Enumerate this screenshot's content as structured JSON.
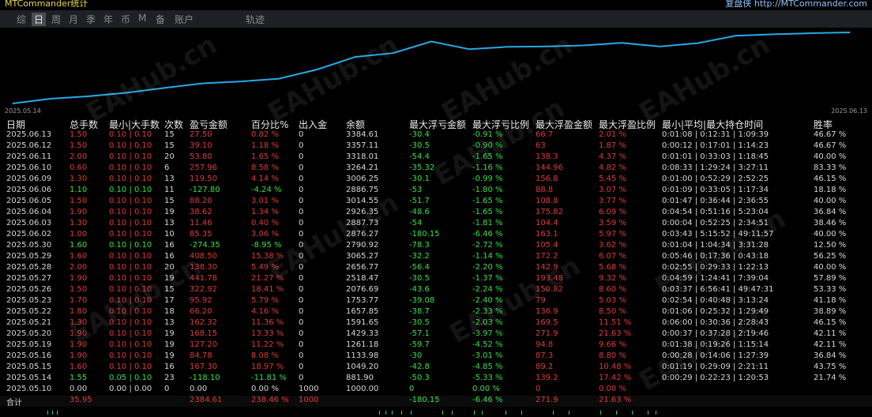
{
  "app": {
    "title": "MTCommander统计",
    "author_label": "复盘侠 http://MTCommander.com"
  },
  "tabs": [
    "综",
    "日",
    "周",
    "月",
    "季",
    "年",
    "币",
    "M",
    "备",
    "账户",
    "轨迹"
  ],
  "active_tab": 1,
  "chart": {
    "start_date": "2025.05.14",
    "end_date": "2025.06.13",
    "line_color": "#27a9e6",
    "values": [
      881.9,
      1049.2,
      1133.98,
      1261.18,
      1429.33,
      1591.65,
      1657.85,
      1753.77,
      2076.69,
      2518.47,
      2656.77,
      3065.27,
      2790.92,
      2876.27,
      2887.73,
      2926.35,
      3014.55,
      2886.75,
      3006.25,
      3264.21,
      3318.01,
      3357.11,
      3384.61
    ],
    "watermark": "EAHub.cn"
  },
  "headers": [
    "日期",
    "总手数",
    "最小|大手数",
    "次数",
    "盈亏金额",
    "百分比%",
    "出入金",
    "余额",
    "最大浮亏金额",
    "最大浮亏比例",
    "最大浮盈金额",
    "最大浮盈比例",
    "最小|平均|最大持仓时间",
    "胜率"
  ],
  "rows": [
    [
      "2025.06.13",
      "1.50",
      "0.10 | 0.10",
      "15",
      "27.50",
      "0.82 %",
      "0",
      "3384.61",
      "-30.4",
      "-0.91 %",
      "66.7",
      "2.01 %",
      "0:01:08 | 0:12:31 | 1:09:39",
      "46.67 %"
    ],
    [
      "2025.06.12",
      "1.50",
      "0.10 | 0.10",
      "15",
      "39.10",
      "1.18 %",
      "0",
      "3357.11",
      "-30.5",
      "-0.90 %",
      "63",
      "1.87 %",
      "0:00:12 | 0:17:01 | 1:14:23",
      "46.67 %"
    ],
    [
      "2025.06.11",
      "2.00",
      "0.10 | 0.10",
      "20",
      "53.80",
      "1.65 %",
      "0",
      "3318.01",
      "-54.4",
      "-1.65 %",
      "138.3",
      "4.37 %",
      "0:01:01 | 0:33:03 | 1:18:45",
      "40.00 %"
    ],
    [
      "2025.06.10",
      "0.60",
      "0.10 | 0.10",
      "6",
      "257.96",
      "8.58 %",
      "0",
      "3264.21",
      "-35.32",
      "-1.16 %",
      "144.96",
      "4.82 %",
      "0:08:33 | 1:29:24 | 3:27:11",
      "83.33 %"
    ],
    [
      "2025.06.09",
      "1.30",
      "0.10 | 0.10",
      "13",
      "119.50",
      "4.14 %",
      "0",
      "3006.25",
      "-30.1",
      "-0.99 %",
      "156.8",
      "5.45 %",
      "0:01:00 | 0:52:29 | 2:52:25",
      "46.15 %"
    ],
    [
      "2025.06.06",
      "1.10",
      "0.10 | 0.10",
      "11",
      "-127.80",
      "-4.24 %",
      "0",
      "2886.75",
      "-53",
      "-1.80 %",
      "88.8",
      "3.07 %",
      "0:01:09 | 0:33:05 | 1:17:34",
      "18.18 %"
    ],
    [
      "2025.06.05",
      "1.50",
      "0.10 | 0.10",
      "15",
      "88.20",
      "3.01 %",
      "0",
      "3014.55",
      "-51.7",
      "-1.65 %",
      "108.8",
      "3.77 %",
      "0:01:47 | 0:36:44 | 2:36:55",
      "40.00 %"
    ],
    [
      "2025.06.04",
      "1.90",
      "0.10 | 0.10",
      "19",
      "38.62",
      "1.34 %",
      "0",
      "2926.35",
      "-48.6",
      "-1.65 %",
      "175.82",
      "6.09 %",
      "0:04:54 | 0:51:16 | 5:23:04",
      "36.84 %"
    ],
    [
      "2025.06.03",
      "1.30",
      "0.10 | 0.10",
      "13",
      "11.46",
      "0.40 %",
      "0",
      "2887.73",
      "-54",
      "-1.81 %",
      "104.4",
      "3.59 %",
      "0:00:04 | 0:52:25 | 2:34:51",
      "38.46 %"
    ],
    [
      "2025.06.02",
      "1.00",
      "0.10 | 0.10",
      "10",
      "85.35",
      "3.06 %",
      "0",
      "2876.27",
      "-180.15",
      "-6.46 %",
      "163.1",
      "5.97 %",
      "0:03:43 | 5:15:52 | 49:11:57",
      "40.00 %"
    ],
    [
      "2025.05.30",
      "1.60",
      "0.10 | 0.10",
      "16",
      "-274.35",
      "-8.95 %",
      "0",
      "2790.92",
      "-78.3",
      "-2.72 %",
      "105.4",
      "3.62 %",
      "0:01:04 | 1:04:34 | 3:31:28",
      "12.50 %"
    ],
    [
      "2025.05.29",
      "1.60",
      "0.10 | 0.10",
      "16",
      "408.50",
      "15.38 %",
      "0",
      "3065.27",
      "-32.2",
      "-1.14 %",
      "172.2",
      "6.07 %",
      "0:05:46 | 0:17:36 | 0:43:18",
      "56.25 %"
    ],
    [
      "2025.05.28",
      "2.00",
      "0.10 | 0.10",
      "20",
      "138.30",
      "5.49 %",
      "0",
      "2656.77",
      "-56.4",
      "-2.20 %",
      "142.9",
      "5.68 %",
      "0:02:55 | 0:29:33 | 1:22:13",
      "40.00 %"
    ],
    [
      "2025.05.27",
      "1.90",
      "0.10 | 0.10",
      "19",
      "441.78",
      "21.27 %",
      "0",
      "2518.47",
      "-30.5",
      "-1.37 %",
      "193.48",
      "9.32 %",
      "0:04:59 | 1:24:41 | 7:39:04",
      "57.89 %"
    ],
    [
      "2025.05.26",
      "1.50",
      "0.10 | 0.10",
      "15",
      "322.92",
      "18.41 %",
      "0",
      "2076.69",
      "-43.6",
      "-2.24 %",
      "150.82",
      "8.60 %",
      "0:03:37 | 6:56:41 | 49:47:31",
      "53.33 %"
    ],
    [
      "2025.05.23",
      "1.70",
      "0.10 | 0.10",
      "17",
      "95.92",
      "5.79 %",
      "0",
      "1753.77",
      "-39.08",
      "-2.40 %",
      "79",
      "5.03 %",
      "0:02:54 | 0:40:48 | 3:13:24",
      "41.18 %"
    ],
    [
      "2025.05.22",
      "1.80",
      "0.10 | 0.10",
      "18",
      "66.20",
      "4.16 %",
      "0",
      "1657.85",
      "-38.7",
      "-2.33 %",
      "136.9",
      "8.50 %",
      "0:01:06 | 0:25:32 | 1:29:49",
      "38.89 %"
    ],
    [
      "2025.05.21",
      "1.30",
      "0.10 | 0.10",
      "13",
      "162.32",
      "11.36 %",
      "0",
      "1591.65",
      "-30.5",
      "-2.03 %",
      "169.5",
      "11.51 %",
      "0:06:00 | 0:30:36 | 2:28:43",
      "46.15 %"
    ],
    [
      "2025.05.20",
      "1.90",
      "0.10 | 0.10",
      "19",
      "168.15",
      "13.33 %",
      "0",
      "1429.33",
      "-57.1",
      "-3.97 %",
      "271.9",
      "21.63 %",
      "0:00:37 | 0:37:28 | 2:19:46",
      "42.11 %"
    ],
    [
      "2025.05.19",
      "1.90",
      "0.10 | 0.10",
      "19",
      "127.20",
      "11.22 %",
      "0",
      "1261.18",
      "-59.7",
      "-4.52 %",
      "94.8",
      "9.66 %",
      "0:01:38 | 0:19:26 | 1:15:14",
      "42.11 %"
    ],
    [
      "2025.05.16",
      "1.90",
      "0.10 | 0.10",
      "19",
      "84.78",
      "8.08 %",
      "0",
      "1133.98",
      "-30",
      "-3.01 %",
      "87.3",
      "8.80 %",
      "0:00:28 | 0:14:06 | 1:27:39",
      "36.84 %"
    ],
    [
      "2025.05.15",
      "1.60",
      "0.10 | 0.10",
      "16",
      "167.30",
      "18.97 %",
      "0",
      "1049.20",
      "-42.8",
      "-4.85 %",
      "89.2",
      "10.48 %",
      "0:01:19 | 0:29:09 | 2:21:11",
      "43.75 %"
    ],
    [
      "2025.05.14",
      "1.55",
      "0.05 | 0.10",
      "23",
      "-118.10",
      "-11.81 %",
      "0",
      "881.90",
      "-50.3",
      "-5.33 %",
      "139.2",
      "17.42 %",
      "0:00:29 | 0:22:23 | 1:20:53",
      "21.74 %"
    ],
    [
      "2025.05.10",
      "0.00",
      "0.00 | 0.00",
      "0",
      "0.00",
      "0.00 %",
      "1000",
      "1000.00",
      "0",
      "0.00 %",
      "0",
      "0.00 %",
      "",
      ""
    ]
  ],
  "sum_row": [
    "合计",
    "35.95",
    "",
    "",
    "2384.61",
    "238.46 %",
    "1000",
    "",
    "-180.15",
    "-6.46 %",
    "271.9",
    "21.63 %",
    "",
    ""
  ]
}
